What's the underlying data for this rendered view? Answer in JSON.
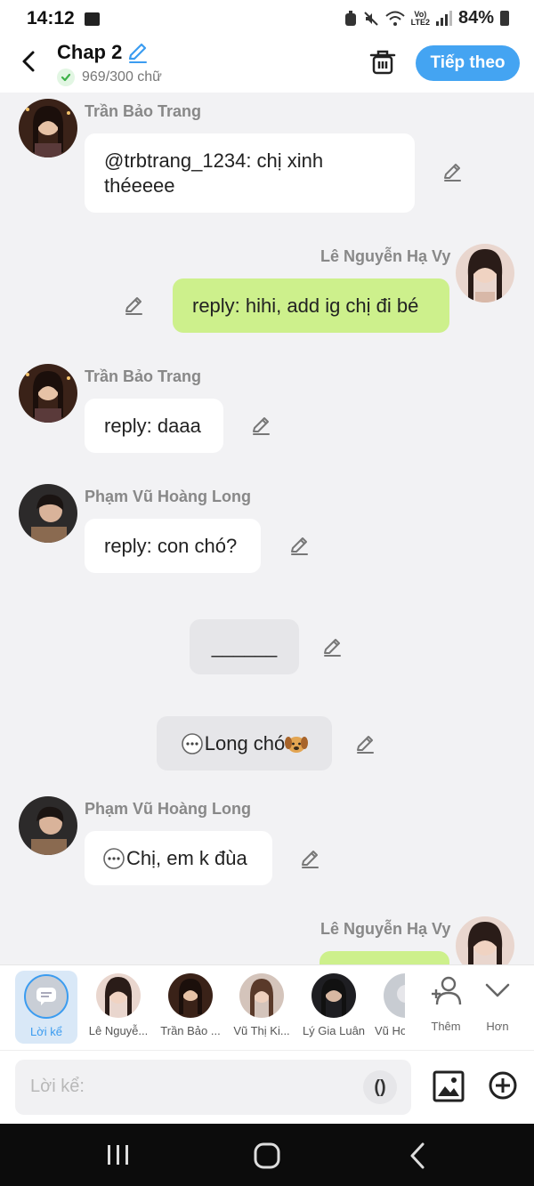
{
  "status": {
    "time": "14:12",
    "network": "LTE2",
    "volte": "Vo)",
    "battery": "84%"
  },
  "header": {
    "title": "Chap 2",
    "word_count": "969/300 chữ",
    "next_label": "Tiếp theo"
  },
  "messages": [
    {
      "sender": "Trần Bảo Trang",
      "text": "@trbtrang_1234: chị xinh théeeee"
    },
    {
      "sender": "Lê Nguyễn Hạ Vy",
      "text": "reply: hihi, add ig chị đi bé"
    },
    {
      "sender": "Trần Bảo Trang",
      "text": "reply: daaa"
    },
    {
      "sender": "Phạm Vũ Hoàng Long",
      "text": "reply: con chó?"
    },
    {
      "text": "______"
    },
    {
      "text": "Long chó"
    },
    {
      "sender": "Phạm Vũ Hoàng Long",
      "text": "Chị, em k đùa"
    },
    {
      "sender": "Lê Nguyễn Hạ Vy",
      "text": ""
    }
  ],
  "characters": {
    "narrator": "Lời kể",
    "list": [
      "Lê Nguyễ...",
      "Trần Bảo ...",
      "Vũ Thị Ki...",
      "Lý Gia Luân",
      "Vũ Hoàng L"
    ],
    "add_label": "Thêm",
    "more_label": "Hơn"
  },
  "input": {
    "placeholder": "Lời kể:",
    "paren_label": "()"
  },
  "colors": {
    "accent": "#44a4f2",
    "my_bubble": "#cdf08c",
    "background": "#f2f2f4"
  },
  "icons": [
    "back-arrow-icon",
    "edit-icon",
    "check-icon",
    "trash-icon",
    "pencil-icon",
    "chat-dots-icon",
    "dog-icon",
    "narrator-icon",
    "add-person-icon",
    "chevron-down-icon",
    "image-icon",
    "plus-circle-icon"
  ]
}
